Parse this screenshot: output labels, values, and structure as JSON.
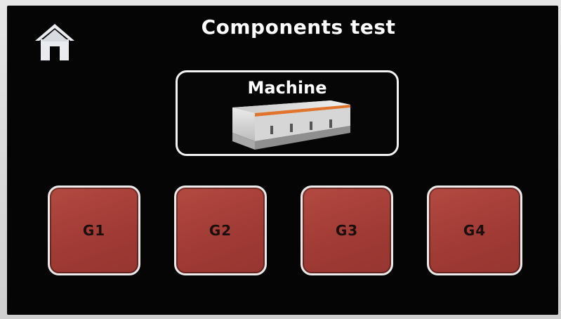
{
  "header": {
    "title": "Components test",
    "home_icon": "home-icon"
  },
  "machine": {
    "label": "Machine",
    "image": "espresso-machine-image"
  },
  "groups": [
    {
      "label": "G1"
    },
    {
      "label": "G2"
    },
    {
      "label": "G3"
    },
    {
      "label": "G4"
    }
  ],
  "colors": {
    "background": "#050505",
    "group_button": "#a63d37",
    "border": "#eaeaea",
    "text": "#ffffff",
    "group_text": "#1a0f0e"
  }
}
